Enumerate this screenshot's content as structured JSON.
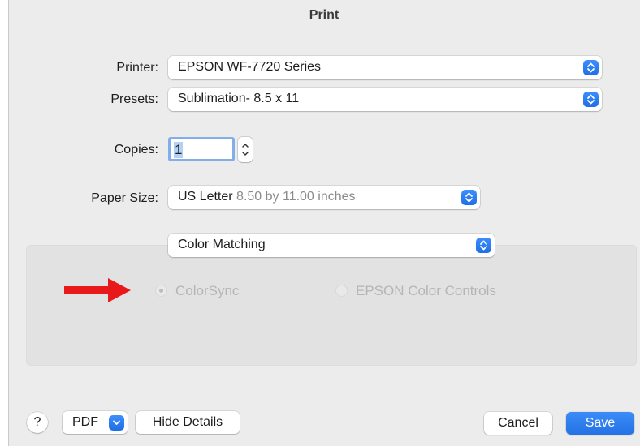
{
  "window": {
    "title": "Print"
  },
  "printer": {
    "label": "Printer:",
    "value": "EPSON WF-7720 Series"
  },
  "presets": {
    "label": "Presets:",
    "value": "Sublimation- 8.5 x 11"
  },
  "copies": {
    "label": "Copies:",
    "value": "1"
  },
  "paper_size": {
    "label": "Paper Size:",
    "value": "US Letter",
    "detail": "8.50 by 11.00 inches"
  },
  "section": {
    "selected": "Color Matching",
    "options": [
      {
        "label": "ColorSync",
        "selected": true,
        "enabled": false
      },
      {
        "label": "EPSON Color Controls",
        "selected": false,
        "enabled": false
      }
    ]
  },
  "annotation": {
    "arrow_color": "#e8191a",
    "icon": "arrow-right-icon"
  },
  "footer": {
    "help_label": "?",
    "pdf_label": "PDF",
    "hide_details_label": "Hide Details",
    "cancel_label": "Cancel",
    "save_label": "Save"
  },
  "colors": {
    "accent": "#2472e6",
    "window_bg": "#ececec"
  }
}
